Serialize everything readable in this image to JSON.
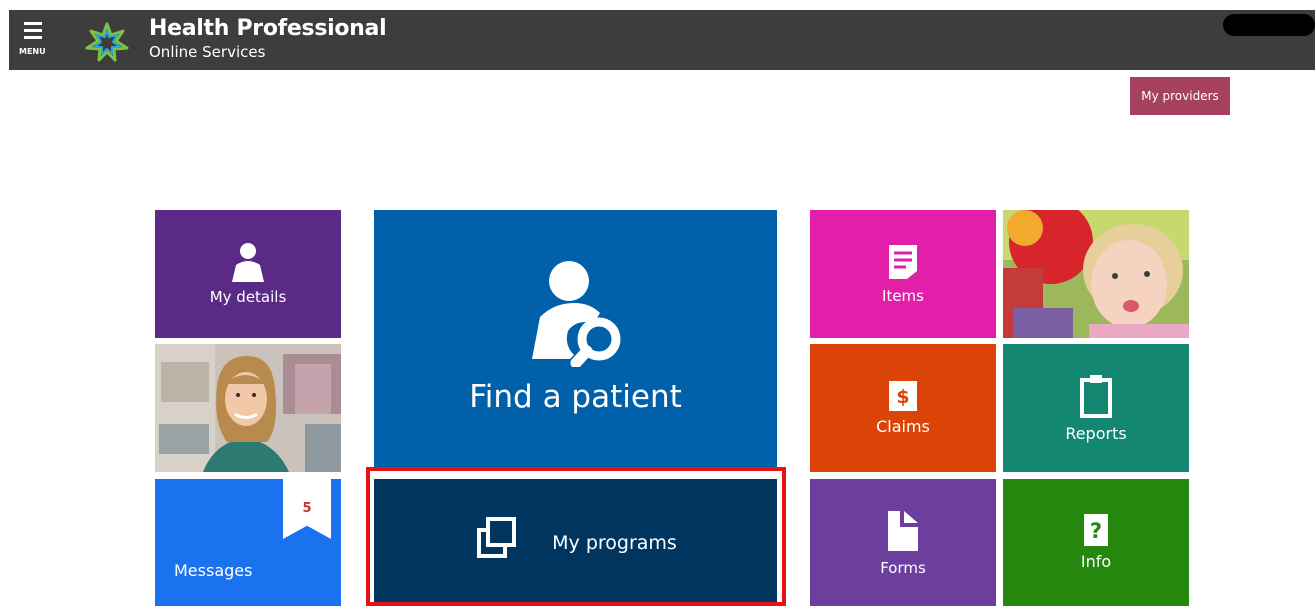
{
  "header": {
    "menu_label": "MENU",
    "title": "Health Professional",
    "subtitle": "Online Services"
  },
  "providers_button": "My providers",
  "tiles": {
    "my_details": "My details",
    "find_patient": "Find a patient",
    "messages": "Messages",
    "messages_count": "5",
    "my_programs": "My programs",
    "items": "Items",
    "claims": "Claims",
    "reports": "Reports",
    "forms": "Forms",
    "info": "Info"
  },
  "colors": {
    "header_bg": "#3d3d3d",
    "providers": "#a6415e",
    "my_details": "#5b2a86",
    "find_patient": "#0060a9",
    "messages": "#1a72ee",
    "my_programs": "#003560",
    "items": "#e21fa9",
    "claims": "#dc4307",
    "reports": "#148772",
    "forms": "#6c3f9e",
    "info": "#25870d",
    "highlight": "#e41414"
  }
}
